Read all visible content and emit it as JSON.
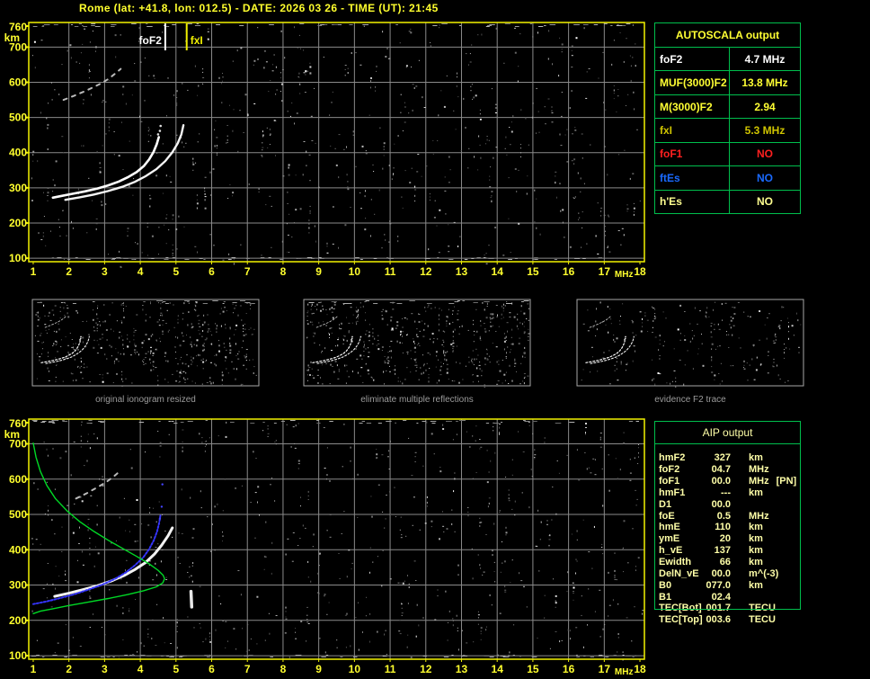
{
  "title": {
    "text": "Rome (lat: +41.8, lon: 012.5) - DATE: 2026 03 26 - TIME (UT): 21:45"
  },
  "colors": {
    "background": "#000000",
    "axis_yellow": "#ffff2e",
    "plot_border": "#f2f200",
    "grid_gray": "#8a8a8a",
    "table_green": "#00bf4d",
    "caption_gray": "#9b9b9b",
    "aip_text": "#ffffa8",
    "trace_white": "#ffffff",
    "trace_blue": "#3535ff",
    "profile_green": "#00d926",
    "status_red": "#ff2020",
    "status_blue": "#1a6aff"
  },
  "autoscala": {
    "header": "AUTOSCALA output",
    "rows": [
      {
        "label": "foF2",
        "value": "4.7 MHz",
        "color": "#ffffff"
      },
      {
        "label": "MUF(3000)F2",
        "value": "13.8 MHz",
        "color": "#ffff33"
      },
      {
        "label": "M(3000)F2",
        "value": "2.94",
        "color": "#ffff33"
      },
      {
        "label": "fxI",
        "value": "5.3 MHz",
        "color": "#cfc400"
      },
      {
        "label": "foF1",
        "value": "NO",
        "color": "#ff2020"
      },
      {
        "label": "ftEs",
        "value": "NO",
        "color": "#1a6aff"
      },
      {
        "label": "h'Es",
        "value": "NO",
        "color": "#ffff90"
      }
    ]
  },
  "aip": {
    "header": "AIP output",
    "rows": [
      {
        "label": "hmF2",
        "value": "327",
        "unit": "km",
        "note": ""
      },
      {
        "label": "foF2",
        "value": "04.7",
        "unit": "MHz",
        "note": ""
      },
      {
        "label": "foF1",
        "value": "00.0",
        "unit": "MHz",
        "note": "[PN]"
      },
      {
        "label": "hmF1",
        "value": "---",
        "unit": "km",
        "note": ""
      },
      {
        "label": "D1",
        "value": "00.0",
        "unit": "",
        "note": ""
      },
      {
        "label": "foE",
        "value": "0.5",
        "unit": "MHz",
        "note": ""
      },
      {
        "label": "hmE",
        "value": "110",
        "unit": "km",
        "note": ""
      },
      {
        "label": "ymE",
        "value": "20",
        "unit": "km",
        "note": ""
      },
      {
        "label": "h_vE",
        "value": "137",
        "unit": "km",
        "note": ""
      },
      {
        "label": "Ewidth",
        "value": "66",
        "unit": "km",
        "note": ""
      },
      {
        "label": "DelN_vE",
        "value": "00.0",
        "unit": "m^(-3)",
        "note": ""
      },
      {
        "label": "B0",
        "value": "077.0",
        "unit": "km",
        "note": ""
      },
      {
        "label": "B1",
        "value": "02.4",
        "unit": "",
        "note": ""
      },
      {
        "label": "TEC[Bot]",
        "value": "001.7",
        "unit": "TECU",
        "note": ""
      },
      {
        "label": "TEC[Top]",
        "value": "003.6",
        "unit": "TECU",
        "note": ""
      }
    ]
  },
  "thumbnails": {
    "captions": [
      "original ionogram resized",
      "eliminate multiple reflections",
      "evidence F2 trace"
    ]
  },
  "chart_data": [
    {
      "id": "top-ionogram",
      "type": "scatter",
      "title": "ionogram with autoscala markers",
      "xlabel": "MHz",
      "ylabel": "km",
      "xlim": [
        0.875,
        18.125
      ],
      "ylim": [
        90,
        770
      ],
      "x_ticks": [
        1,
        2,
        3,
        4,
        5,
        6,
        7,
        8,
        9,
        10,
        11,
        12,
        13,
        14,
        15,
        16,
        17,
        18
      ],
      "y_ticks": [
        760,
        700,
        600,
        500,
        400,
        300,
        200,
        100
      ],
      "grid": true,
      "legend": "none",
      "noise": {
        "seed": 11,
        "count": 620,
        "edge": true
      },
      "series": [
        {
          "name": "F2 O-trace",
          "style": "line",
          "color": "#ffffff",
          "width": 2.6,
          "points": [
            [
              1.55,
              272
            ],
            [
              1.8,
              277
            ],
            [
              2.1,
              283
            ],
            [
              2.45,
              290
            ],
            [
              2.8,
              298
            ],
            [
              3.1,
              307
            ],
            [
              3.4,
              318
            ],
            [
              3.65,
              330
            ],
            [
              3.9,
              345
            ],
            [
              4.1,
              362
            ],
            [
              4.25,
              381
            ],
            [
              4.37,
              402
            ],
            [
              4.46,
              424
            ],
            [
              4.52,
              444
            ]
          ]
        },
        {
          "name": "F2 X-trace",
          "style": "line",
          "color": "#f5f5f5",
          "width": 2.4,
          "points": [
            [
              1.9,
              266
            ],
            [
              2.3,
              273
            ],
            [
              2.7,
              281
            ],
            [
              3.1,
              291
            ],
            [
              3.5,
              303
            ],
            [
              3.85,
              317
            ],
            [
              4.15,
              333
            ],
            [
              4.45,
              353
            ],
            [
              4.7,
              376
            ],
            [
              4.9,
              401
            ],
            [
              5.05,
              427
            ],
            [
              5.15,
              452
            ],
            [
              5.21,
              478
            ]
          ]
        },
        {
          "name": "O-trace cusp dots",
          "style": "dots",
          "color": "#e0e0e0",
          "r": 1.3,
          "points": [
            [
              4.5,
              452
            ],
            [
              4.55,
              462
            ],
            [
              4.57,
              476
            ]
          ]
        },
        {
          "name": "second-hop trace",
          "style": "dash",
          "color": "#b9b9b9",
          "width": 2,
          "dash": "4,6",
          "points": [
            [
              1.85,
              550
            ],
            [
              2.15,
              562
            ],
            [
              2.5,
              577
            ],
            [
              2.85,
              594
            ],
            [
              3.1,
              609
            ],
            [
              3.3,
              625
            ],
            [
              3.45,
              638
            ]
          ]
        }
      ],
      "markers": [
        {
          "x": 4.7,
          "label": "foF2",
          "color": "#ffffff",
          "side": "left"
        },
        {
          "x": 5.3,
          "label": "fxI",
          "color": "#f0f000",
          "side": "right"
        }
      ]
    },
    {
      "id": "bottom-ionogram",
      "type": "scatter",
      "title": "ionogram with restored trace and electron density profile",
      "xlabel": "MHz",
      "ylabel": "km",
      "xlim": [
        0.875,
        18.125
      ],
      "ylim": [
        90,
        770
      ],
      "x_ticks": [
        1,
        2,
        3,
        4,
        5,
        6,
        7,
        8,
        9,
        10,
        11,
        12,
        13,
        14,
        15,
        16,
        17,
        18
      ],
      "y_ticks": [
        760,
        700,
        600,
        500,
        400,
        300,
        200,
        100
      ],
      "grid": true,
      "legend": "none",
      "noise": {
        "seed": 29,
        "count": 620,
        "edge": true
      },
      "series": [
        {
          "name": "measured F2 trace",
          "style": "line",
          "color": "#f2f2f2",
          "width": 3,
          "points": [
            [
              1.6,
              268
            ],
            [
              2.0,
              277
            ],
            [
              2.4,
              287
            ],
            [
              2.8,
              298
            ],
            [
              3.2,
              312
            ],
            [
              3.55,
              327
            ],
            [
              3.85,
              344
            ],
            [
              4.15,
              364
            ],
            [
              4.4,
              388
            ],
            [
              4.6,
              413
            ],
            [
              4.78,
              440
            ],
            [
              4.9,
              462
            ]
          ]
        },
        {
          "name": "second-hop trace",
          "style": "dash",
          "color": "#b9b9b9",
          "width": 2,
          "dash": "4,6",
          "points": [
            [
              2.2,
              545
            ],
            [
              2.5,
              560
            ],
            [
              2.8,
              577
            ],
            [
              3.05,
              592
            ],
            [
              3.25,
              607
            ],
            [
              3.4,
              620
            ]
          ]
        },
        {
          "name": "autoscala O-trace",
          "style": "dash",
          "color": "#3535ff",
          "width": 2,
          "dash": "2,2",
          "points": [
            [
              1.0,
              246
            ],
            [
              1.35,
              253
            ],
            [
              1.75,
              263
            ],
            [
              2.15,
              274
            ],
            [
              2.55,
              287
            ],
            [
              2.95,
              302
            ],
            [
              3.3,
              318
            ],
            [
              3.6,
              336
            ],
            [
              3.85,
              356
            ],
            [
              4.08,
              378
            ],
            [
              4.25,
              402
            ],
            [
              4.38,
              427
            ],
            [
              4.47,
              452
            ],
            [
              4.53,
              476
            ],
            [
              4.57,
              500
            ]
          ]
        },
        {
          "name": "autoscala trace sparse dots",
          "style": "dots",
          "color": "#4444ff",
          "r": 1.2,
          "points": [
            [
              4.6,
              522
            ],
            [
              4.62,
              585
            ],
            [
              4.55,
              488
            ]
          ]
        },
        {
          "name": "electron density profile",
          "style": "line",
          "color": "#00d926",
          "width": 1.4,
          "points": [
            [
              1.0,
              702
            ],
            [
              1.08,
              662
            ],
            [
              1.2,
              622
            ],
            [
              1.38,
              582
            ],
            [
              1.62,
              545
            ],
            [
              1.95,
              510
            ],
            [
              2.3,
              480
            ],
            [
              2.7,
              452
            ],
            [
              3.1,
              427
            ],
            [
              3.5,
              404
            ],
            [
              3.9,
              381
            ],
            [
              4.25,
              360
            ],
            [
              4.5,
              342
            ],
            [
              4.64,
              328
            ],
            [
              4.68,
              318
            ],
            [
              4.63,
              306
            ],
            [
              4.45,
              295
            ],
            [
              4.1,
              284
            ],
            [
              3.65,
              273
            ],
            [
              3.1,
              262
            ],
            [
              2.55,
              252
            ],
            [
              2.0,
              242
            ],
            [
              1.55,
              233
            ],
            [
              1.2,
              226
            ],
            [
              1.0,
              219
            ]
          ]
        },
        {
          "name": "noise streak",
          "style": "line",
          "color": "#e8e8e8",
          "width": 3.5,
          "points": [
            [
              5.44,
              238
            ],
            [
              5.42,
              282
            ]
          ]
        }
      ],
      "markers": []
    },
    {
      "id": "thumb-1",
      "type": "scatter",
      "title": "original ionogram resized",
      "xlim": [
        0.875,
        18.125
      ],
      "ylim": [
        90,
        770
      ],
      "grid": false,
      "thumb": true,
      "series_from": "top-ionogram",
      "noise": {
        "seed": 3,
        "count": 400,
        "edge": true
      }
    },
    {
      "id": "thumb-2",
      "type": "scatter",
      "title": "eliminate multiple reflections",
      "xlim": [
        0.875,
        18.125
      ],
      "ylim": [
        90,
        770
      ],
      "grid": false,
      "thumb": true,
      "series_from": "top-ionogram",
      "noise": {
        "seed": 4,
        "count": 430,
        "edge": true
      }
    },
    {
      "id": "thumb-3",
      "type": "scatter",
      "title": "evidence F2 trace",
      "xlim": [
        0.875,
        18.125
      ],
      "ylim": [
        90,
        770
      ],
      "grid": false,
      "thumb": true,
      "series_from": "top-ionogram",
      "noise": {
        "seed": 5,
        "count": 210,
        "edge": false
      }
    }
  ]
}
